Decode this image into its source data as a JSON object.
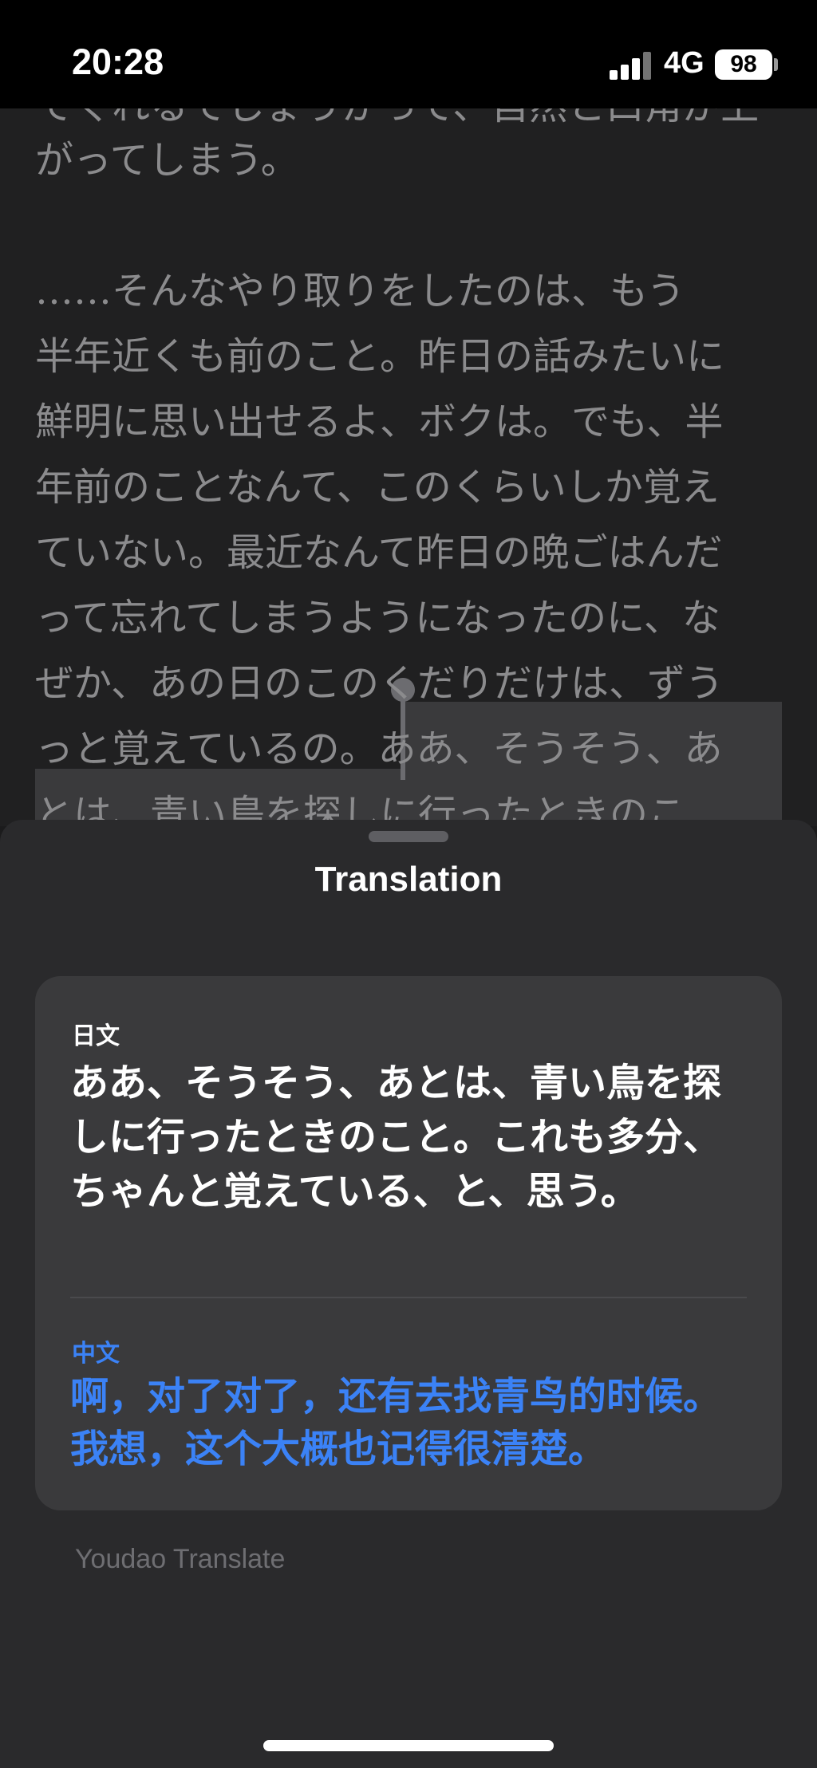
{
  "status_bar": {
    "time": "20:28",
    "network": "4G",
    "battery": "98"
  },
  "reader": {
    "lines": [
      "でくれるでしょうかって、自然と口角が上",
      "がってしまう。",
      "",
      "……そんなやり取りをしたのは、もう",
      "半年近くも前のこと。昨日の話みたいに",
      "鮮明に思い出せるよ、ボクは。でも、半",
      "年前のことなんて、このくらいしか覚え",
      "ていない。最近なんて昨日の晩ごはんだ",
      "って忘れてしまうようになったのに、な",
      "ぜか、あの日のこのくだりだけは、ずう",
      "っと覚えているの。ああ、そうそう、あ",
      "とは、青い鳥を探しに行ったときのこ"
    ]
  },
  "sheet": {
    "title": "Translation",
    "source_language": "日文",
    "source_text": "ああ、そうそう、あとは、青い鳥を探しに行ったときのこと。これも多分、ちゃんと覚えている、と、思う。",
    "target_language": "中文",
    "target_text": "啊，对了对了，还有去找青鸟的时候。我想，这个大概也记得很清楚。",
    "provider": "Youdao Translate"
  }
}
